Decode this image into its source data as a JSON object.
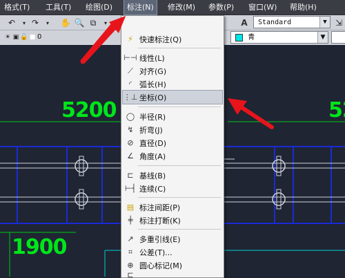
{
  "menubar": {
    "items": [
      "格式(T)",
      "工具(T)",
      "绘图(D)",
      "标注(N)",
      "修改(M)",
      "参数(P)",
      "窗口(W)",
      "帮助(H)"
    ]
  },
  "toolbar": {
    "text_style": "Standard",
    "layer_name": "0",
    "color_name": "青"
  },
  "drawing": {
    "dim_5200": "5200",
    "dim_52": "52",
    "dim_1900": "1900"
  },
  "dimension_menu": {
    "items": [
      {
        "label": "快速标注(Q)",
        "icon": "quick-dim-icon"
      },
      {
        "label": "线性(L)",
        "icon": "linear-icon"
      },
      {
        "label": "对齐(G)",
        "icon": "aligned-icon"
      },
      {
        "label": "弧长(H)",
        "icon": "arc-length-icon"
      },
      {
        "label": "坐标(O)",
        "icon": "ordinate-icon"
      },
      {
        "label": "半径(R)",
        "icon": "radius-icon"
      },
      {
        "label": "折弯(J)",
        "icon": "jogged-icon"
      },
      {
        "label": "直径(D)",
        "icon": "diameter-icon"
      },
      {
        "label": "角度(A)",
        "icon": "angle-icon"
      },
      {
        "label": "基线(B)",
        "icon": "baseline-icon"
      },
      {
        "label": "连续(C)",
        "icon": "continue-icon"
      },
      {
        "label": "标注间距(P)",
        "icon": "dim-space-icon"
      },
      {
        "label": "标注打断(K)",
        "icon": "dim-break-icon"
      },
      {
        "label": "多重引线(E)",
        "icon": "multileader-icon"
      },
      {
        "label": "公差(T)...",
        "icon": "tolerance-icon"
      },
      {
        "label": "圆心标记(M)",
        "icon": "center-mark-icon"
      }
    ],
    "highlighted_index": 4
  },
  "colors": {
    "menubar_bg": "#3a3d44",
    "canvas_bg": "#1f2533",
    "dim_text": "#00e61a",
    "blue_lines": "#1a2bd6",
    "arrow": "#e8141b",
    "cyan_swatch": "#00e5e5"
  }
}
